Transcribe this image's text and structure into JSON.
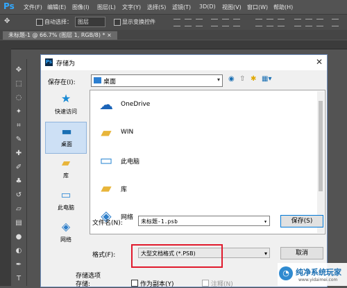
{
  "app": {
    "logo": "Ps"
  },
  "menu": [
    "文件(F)",
    "编辑(E)",
    "图像(I)",
    "图层(L)",
    "文字(Y)",
    "选择(S)",
    "滤镜(T)",
    "3D(D)",
    "视图(V)",
    "窗口(W)",
    "帮助(H)"
  ],
  "options_bar": {
    "auto_select_label": "自动选择：",
    "auto_select_value": "图层",
    "show_transform_label": "显示变换控件"
  },
  "document_tab": {
    "title": "未标题-1 @ 66.7% (图层 1, RGB/8) *",
    "close": "×"
  },
  "dialog": {
    "title": "存储为",
    "close": "✕",
    "save_in_label": "保存在(I):",
    "save_in_value": "桌面",
    "places": [
      {
        "label": "快速访问",
        "icon": "star-icon"
      },
      {
        "label": "桌面",
        "icon": "desktop-icon"
      },
      {
        "label": "库",
        "icon": "library-icon"
      },
      {
        "label": "此电脑",
        "icon": "computer-icon"
      },
      {
        "label": "网络",
        "icon": "network-icon"
      }
    ],
    "files": [
      {
        "label": "OneDrive",
        "icon": "cloud-icon"
      },
      {
        "label": "WIN",
        "icon": "user-folder-icon"
      },
      {
        "label": "此电脑",
        "icon": "computer-icon"
      },
      {
        "label": "库",
        "icon": "library-icon"
      },
      {
        "label": "网络",
        "icon": "network-icon"
      }
    ],
    "filename_label": "文件名(N):",
    "filename_value": "未标题-1.psb",
    "format_label": "格式(F):",
    "format_value": "大型文档格式 (*.PSB)",
    "save_button": "保存(S)",
    "cancel_button": "取消",
    "save_options_label": "存储选项",
    "save_label": "存储:",
    "as_copy_label": "作为副本(Y)",
    "notes_label": "注释(N)"
  },
  "watermark": {
    "name": "纯净系统玩家",
    "url": "www.yidaimei.com"
  },
  "colors": {
    "highlight": "#e0192c",
    "accent": "#31a8ff"
  }
}
